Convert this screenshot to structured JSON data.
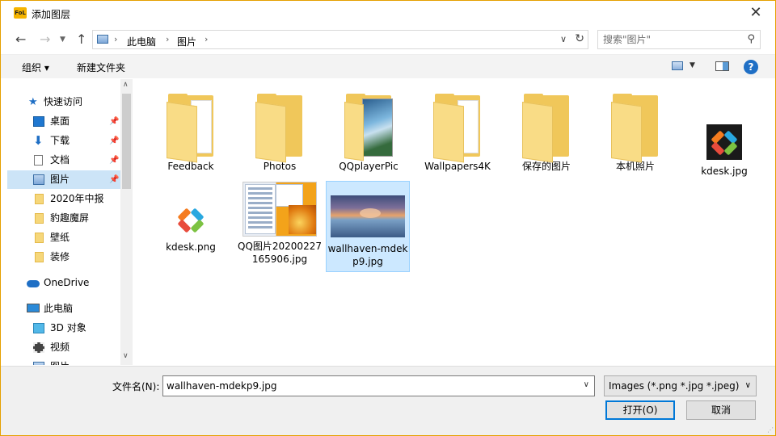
{
  "window": {
    "title": "添加图层",
    "logo_text": "FoL"
  },
  "nav": {
    "breadcrumbs": [
      "此电脑",
      "图片"
    ],
    "search_placeholder": "搜索\"图片\""
  },
  "toolbar": {
    "organize_label": "组织 ▾",
    "new_folder_label": "新建文件夹",
    "help_label": "?"
  },
  "sidebar": {
    "items": [
      {
        "label": "快速访问",
        "icon": "star-icon",
        "pinned": false
      },
      {
        "label": "桌面",
        "icon": "desktop-icon",
        "pinned": true
      },
      {
        "label": "下载",
        "icon": "download-icon",
        "pinned": true
      },
      {
        "label": "文档",
        "icon": "document-icon",
        "pinned": true
      },
      {
        "label": "图片",
        "icon": "pictures-icon",
        "pinned": true,
        "selected": true
      },
      {
        "label": "2020年中报",
        "icon": "folder-icon"
      },
      {
        "label": "豹趣魔屏",
        "icon": "folder-icon"
      },
      {
        "label": "壁纸",
        "icon": "folder-icon"
      },
      {
        "label": "装修",
        "icon": "folder-icon"
      },
      {
        "label": "OneDrive",
        "icon": "onedrive-icon"
      },
      {
        "label": "此电脑",
        "icon": "computer-icon"
      },
      {
        "label": "3D 对象",
        "icon": "cube-icon"
      },
      {
        "label": "视频",
        "icon": "video-icon"
      },
      {
        "label": "图片",
        "icon": "pictures-icon"
      }
    ]
  },
  "files": [
    {
      "name": "Feedback",
      "type": "folder"
    },
    {
      "name": "Photos",
      "type": "folder"
    },
    {
      "name": "QQplayerPic",
      "type": "folder-photo"
    },
    {
      "name": "Wallpapers4K",
      "type": "folder"
    },
    {
      "name": "保存的图片",
      "type": "folder"
    },
    {
      "name": "本机照片",
      "type": "folder"
    },
    {
      "name": "kdesk.jpg",
      "type": "kdesk-dark"
    },
    {
      "name": "kdesk.png",
      "type": "kdesk-light"
    },
    {
      "name": "QQ图片20200227165906.jpg",
      "type": "thumb-qq"
    },
    {
      "name": "wallhaven-mdekp9.jpg",
      "type": "thumb-wall",
      "selected": true
    }
  ],
  "bottom": {
    "filename_label": "文件名(N):",
    "filename_value": "wallhaven-mdekp9.jpg",
    "filter_value": "Images (*.png *.jpg *.jpeg)",
    "open_label": "打开(O)",
    "cancel_label": "取消"
  }
}
